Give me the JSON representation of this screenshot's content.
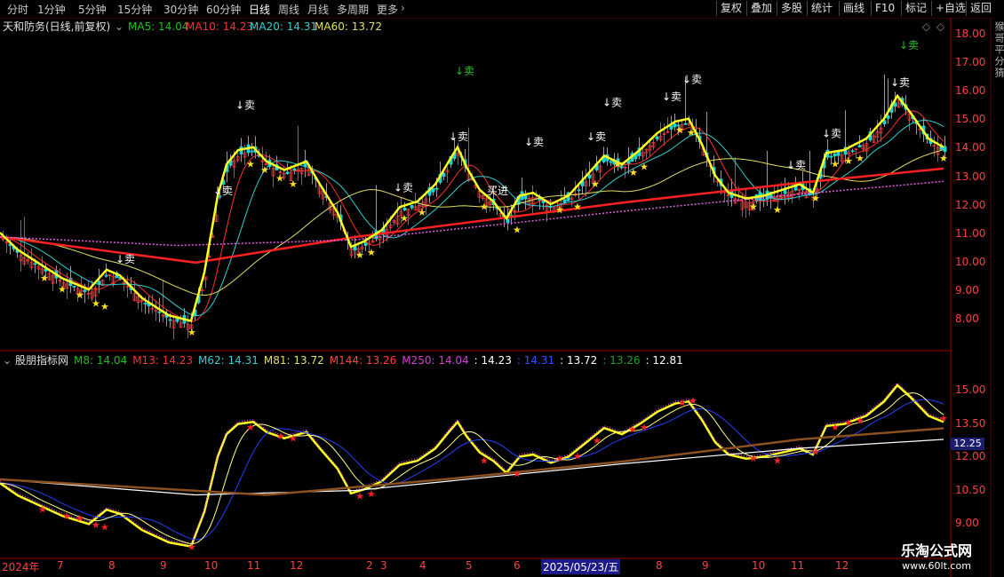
{
  "toolbar": {
    "period_tabs": [
      "分时",
      "1分钟",
      "5分钟",
      "15分钟",
      "30分钟",
      "60分钟",
      "日线",
      "周线",
      "月线",
      "多周期",
      "更多"
    ],
    "active_tab": "日线",
    "right_buttons": [
      "复权",
      "叠加",
      "多股",
      "统计",
      "画线",
      "F10",
      "标记",
      "+自选",
      "返回"
    ]
  },
  "main_panel": {
    "title": "天和防务(日线,前复权)",
    "ma": [
      {
        "label": "MA5: 14.04",
        "color": "#20c020"
      },
      {
        "label": "MA10: 14.23",
        "color": "#ff3030"
      },
      {
        "label": "MA20: 14.31",
        "color": "#30d0d0"
      },
      {
        "label": "MA60: 13.72",
        "color": "#e0e060"
      }
    ],
    "y_ticks": [
      "18.00",
      "17.00",
      "16.00",
      "15.00",
      "14.00",
      "13.00",
      "12.00",
      "11.00",
      "10.00",
      "9.00",
      "8.00"
    ],
    "sell_marker": "↓卖",
    "buy_marker": "买进",
    "right_strip_text": "猴哥平分猜"
  },
  "sub_panel": {
    "title": "股朋指标网",
    "values": [
      {
        "label": "M8: 14.04",
        "color": "#20c020"
      },
      {
        "label": "M13: 14.23",
        "color": "#ff3030"
      },
      {
        "label": "M62: 14.31",
        "color": "#30d0d0"
      },
      {
        "label": "M81: 13.72",
        "color": "#e0e060"
      },
      {
        "label": "M144: 13.26",
        "color": "#ff4040"
      },
      {
        "label": "M250: 14.04",
        "color": "#d040d0"
      },
      {
        "label": ": 14.23",
        "color": "#ffffff"
      },
      {
        "label": ": 14.31",
        "color": "#3050ff"
      },
      {
        "label": ": 13.72",
        "color": "#ffffff"
      },
      {
        "label": ": 13.26",
        "color": "#20a020"
      },
      {
        "label": ": 12.81",
        "color": "#ffffff"
      }
    ],
    "y_ticks": [
      "15.00",
      "13.50",
      "12.00",
      "10.50",
      "9.00"
    ],
    "current_value": "12.25"
  },
  "date_axis": {
    "labels": [
      "2024年",
      "7",
      "8",
      "9",
      "10",
      "11",
      "12",
      "2",
      "3",
      "4",
      "5",
      "6",
      "7",
      "8",
      "9",
      "10",
      "11",
      "12"
    ],
    "cursor_date": "2025/05/23/五"
  },
  "watermark": {
    "line1": "乐淘公式网",
    "line2": "www.60lt.com"
  }
}
